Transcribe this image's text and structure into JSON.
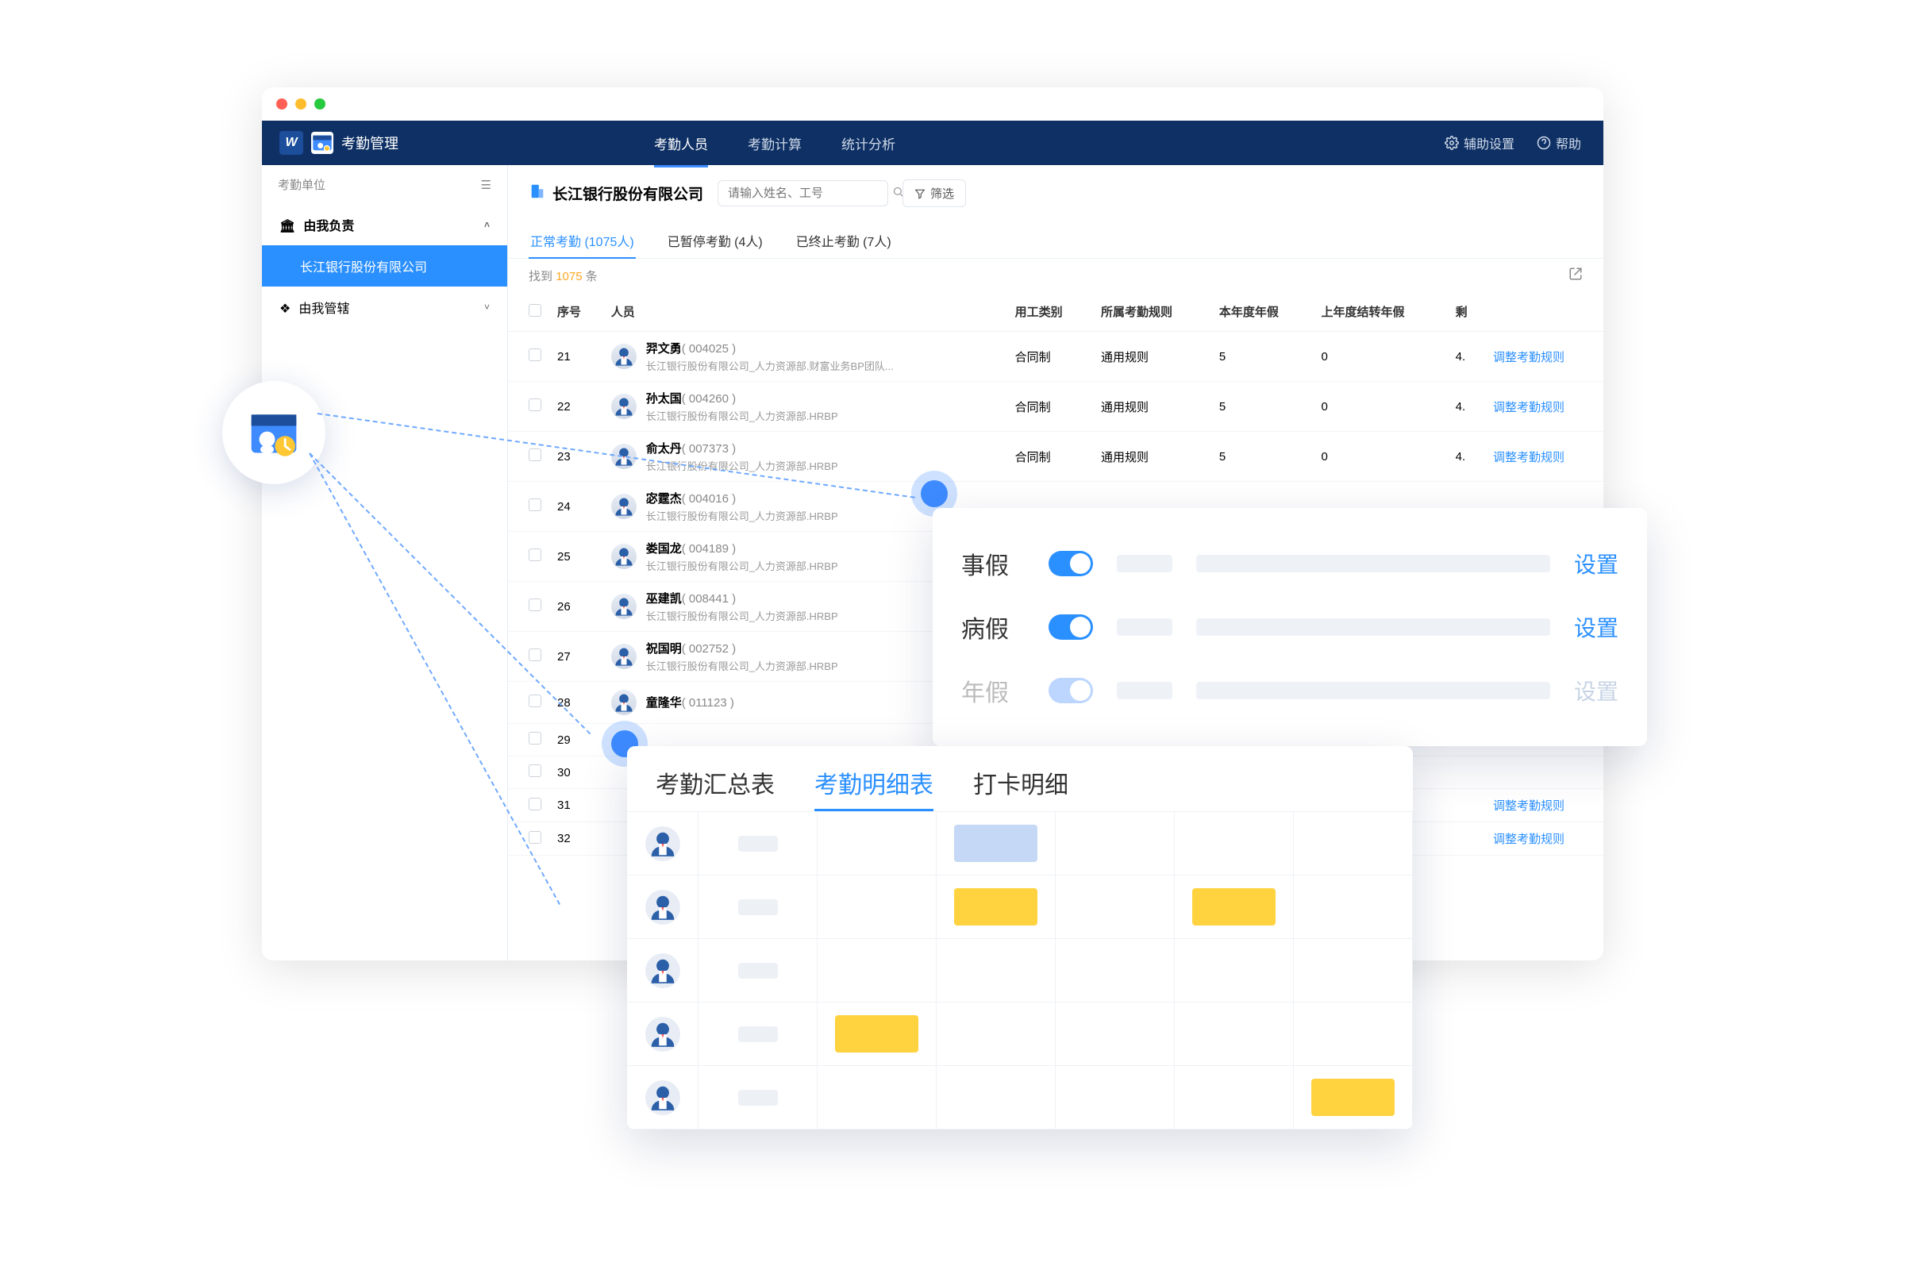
{
  "app_title": "考勤管理",
  "nav": {
    "items": [
      "考勤人员",
      "考勤计算",
      "统计分析"
    ],
    "active": 0
  },
  "top_actions": {
    "aux": "辅助设置",
    "help": "帮助"
  },
  "sidebar": {
    "header": "考勤单位",
    "group1": "由我负责",
    "item_active": "长江银行股份有限公司",
    "group2": "由我管辖"
  },
  "org": {
    "name": "长江银行股份有限公司"
  },
  "search": {
    "placeholder": "请输入姓名、工号"
  },
  "filter_label": "筛选",
  "tabs": [
    {
      "label": "正常考勤 (1075人)",
      "active": true
    },
    {
      "label": "已暂停考勤 (4人)"
    },
    {
      "label": "已终止考勤 (7人)"
    }
  ],
  "result": {
    "prefix": "找到",
    "count": "1075",
    "suffix": "条"
  },
  "columns": [
    "序号",
    "人员",
    "用工类别",
    "所属考勤规则",
    "本年度年假",
    "上年度结转年假",
    "剩"
  ],
  "action_label": "调整考勤规则",
  "rows": [
    {
      "idx": 21,
      "name": "羿文勇",
      "id": "004025",
      "dept": "长江银行股份有限公司_人力资源部.财富业务BP团队...",
      "emp": "合同制",
      "rule": "通用规则",
      "cy": "5",
      "py": "0",
      "rem": "4."
    },
    {
      "idx": 22,
      "name": "孙太国",
      "id": "004260",
      "dept": "长江银行股份有限公司_人力资源部.HRBP",
      "emp": "合同制",
      "rule": "通用规则",
      "cy": "5",
      "py": "0",
      "rem": "4."
    },
    {
      "idx": 23,
      "name": "俞太丹",
      "id": "007373",
      "dept": "长江银行股份有限公司_人力资源部.HRBP",
      "emp": "合同制",
      "rule": "通用规则",
      "cy": "5",
      "py": "0",
      "rem": "4."
    },
    {
      "idx": 24,
      "name": "宓霆杰",
      "id": "004016",
      "dept": "长江银行股份有限公司_人力资源部.HRBP",
      "emp": "",
      "rule": "",
      "cy": "",
      "py": "",
      "rem": ""
    },
    {
      "idx": 25,
      "name": "娄国龙",
      "id": "004189",
      "dept": "长江银行股份有限公司_人力资源部.HRBP",
      "emp": "",
      "rule": "",
      "cy": "",
      "py": "",
      "rem": ""
    },
    {
      "idx": 26,
      "name": "巫建凯",
      "id": "008441",
      "dept": "长江银行股份有限公司_人力资源部.HRBP",
      "emp": "",
      "rule": "",
      "cy": "",
      "py": "",
      "rem": ""
    },
    {
      "idx": 27,
      "name": "祝国明",
      "id": "002752",
      "dept": "长江银行股份有限公司_人力资源部.HRBP",
      "emp": "",
      "rule": "",
      "cy": "",
      "py": "",
      "rem": ""
    },
    {
      "idx": 28,
      "name": "童隆华",
      "id": "011123",
      "dept": "",
      "emp": "",
      "rule": "",
      "cy": "",
      "py": "",
      "rem": ""
    },
    {
      "idx": 29
    },
    {
      "idx": 30
    },
    {
      "idx": 31,
      "rem_only": true
    },
    {
      "idx": 32,
      "rem_only": true
    }
  ],
  "leave_card": {
    "rows": [
      {
        "label": "事假",
        "on": true,
        "set": "设置"
      },
      {
        "label": "病假",
        "on": true,
        "set": "设置"
      },
      {
        "label": "年假",
        "on": true,
        "disabled": true,
        "set": "设置"
      }
    ]
  },
  "detail_card": {
    "tabs": [
      "考勤汇总表",
      "考勤明细表",
      "打卡明细"
    ],
    "active": 1,
    "row_below_label": "调整考勤规则"
  }
}
